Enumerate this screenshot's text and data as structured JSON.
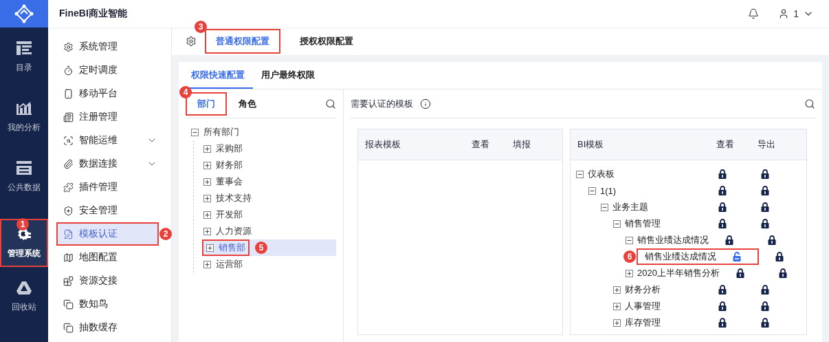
{
  "app": {
    "title": "FineBI商业智能"
  },
  "header": {
    "user": "1"
  },
  "rail": [
    {
      "label": "目录",
      "selected": false
    },
    {
      "label": "我的分析",
      "selected": false
    },
    {
      "label": "公共数据",
      "selected": false
    },
    {
      "label": "管理系统",
      "selected": true,
      "callout": "1"
    },
    {
      "label": "回收站",
      "selected": false
    }
  ],
  "menu": [
    {
      "label": "系统管理",
      "selected": false,
      "expandable": false
    },
    {
      "label": "定时调度",
      "selected": false,
      "expandable": false
    },
    {
      "label": "移动平台",
      "selected": false,
      "expandable": false
    },
    {
      "label": "注册管理",
      "selected": false,
      "expandable": false
    },
    {
      "label": "智能运维",
      "selected": false,
      "expandable": true
    },
    {
      "label": "数据连接",
      "selected": false,
      "expandable": true
    },
    {
      "label": "插件管理",
      "selected": false,
      "expandable": false
    },
    {
      "label": "安全管理",
      "selected": false,
      "expandable": false
    },
    {
      "label": "模板认证",
      "selected": true,
      "expandable": false,
      "callout": "2"
    },
    {
      "label": "地图配置",
      "selected": false,
      "expandable": false
    },
    {
      "label": "资源交接",
      "selected": false,
      "expandable": false
    },
    {
      "label": "数知鸟",
      "selected": false,
      "expandable": false
    },
    {
      "label": "抽数缓存",
      "selected": false,
      "expandable": false
    }
  ],
  "tabs": [
    {
      "label": "普通权限配置",
      "selected": true,
      "callout": "3"
    },
    {
      "label": "授权权限配置",
      "selected": false
    }
  ],
  "sub_tabs": [
    {
      "label": "权限快速配置",
      "selected": true
    },
    {
      "label": "用户最终权限",
      "selected": false
    }
  ],
  "member_tabs": [
    {
      "label": "部门",
      "selected": true,
      "callout": "4"
    },
    {
      "label": "角色",
      "selected": false
    }
  ],
  "department_tree": [
    {
      "label": "所有部门",
      "expanded": true,
      "selected": false,
      "children": [
        {
          "label": "采购部",
          "expanded": false,
          "selected": false
        },
        {
          "label": "财务部",
          "expanded": false,
          "selected": false
        },
        {
          "label": "董事会",
          "expanded": false,
          "selected": false
        },
        {
          "label": "技术支持",
          "expanded": false,
          "selected": false
        },
        {
          "label": "开发部",
          "expanded": false,
          "selected": false
        },
        {
          "label": "人力资源",
          "expanded": false,
          "selected": false
        },
        {
          "label": "销售部",
          "expanded": false,
          "selected": true,
          "callout": "5"
        },
        {
          "label": "运营部",
          "expanded": false,
          "selected": false
        }
      ]
    }
  ],
  "templates_title": "需要认证的模板",
  "report_table": {
    "columns": [
      "报表模板",
      "查看",
      "填报"
    ]
  },
  "bi_table": {
    "columns": [
      "BI模板",
      "查看",
      "导出"
    ],
    "rows": [
      {
        "label": "仪表板",
        "expanded": true,
        "view_locked": true,
        "export_locked": true,
        "children": [
          {
            "label": "1(1)",
            "expanded": true,
            "view_locked": true,
            "export_locked": true,
            "children": [
              {
                "label": "业务主题",
                "expanded": true,
                "view_locked": true,
                "export_locked": true,
                "children": [
                  {
                    "label": "销售管理",
                    "expanded": true,
                    "view_locked": true,
                    "export_locked": true,
                    "children": [
                      {
                        "label": "销售业绩达成情况",
                        "expanded": true,
                        "view_locked": true,
                        "export_locked": true,
                        "children": [
                          {
                            "label": "销售业绩达成情况",
                            "view_locked": false,
                            "export_locked": true,
                            "callout": "6"
                          }
                        ]
                      },
                      {
                        "label": "2020上半年销售分析",
                        "expanded": false,
                        "view_locked": true,
                        "export_locked": true
                      }
                    ]
                  },
                  {
                    "label": "财务分析",
                    "expanded": false,
                    "view_locked": true,
                    "export_locked": true
                  },
                  {
                    "label": "人事管理",
                    "expanded": false,
                    "view_locked": true,
                    "export_locked": true
                  },
                  {
                    "label": "库存管理",
                    "expanded": false,
                    "view_locked": true,
                    "export_locked": true
                  }
                ]
              }
            ]
          }
        ]
      }
    ]
  }
}
